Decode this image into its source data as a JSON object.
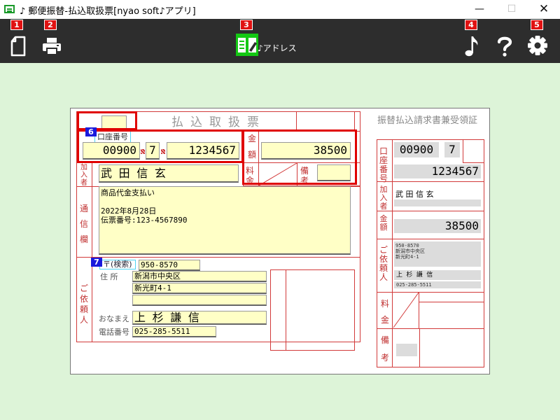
{
  "window": {
    "title": "♪ 郵便振替-払込取扱票[nyao soft♪アプリ]",
    "minimize_glyph": "—",
    "maximize_glyph": "☐",
    "close_glyph": "✕"
  },
  "toolbar": {
    "badges": [
      "1",
      "2",
      "3",
      "4",
      "5"
    ],
    "address_label": "♪アドレス",
    "icons": [
      "new-document-icon",
      "printer-icon",
      "address-book-icon",
      "music-note-icon",
      "help-icon",
      "gear-icon"
    ],
    "accent": "#14c814"
  },
  "form": {
    "title": "払込取扱票",
    "receipt_title": "振替払込請求書兼受領証",
    "tag_account": "6",
    "tag_postal": "7",
    "account": {
      "label": "口座番号",
      "part1": "00900",
      "part2": "7",
      "part3": "1234567"
    },
    "amount": {
      "label_1": "金",
      "label_2": "額",
      "value": "38500"
    },
    "fee": {
      "label_1": "料",
      "label_2": "金"
    },
    "remarks": {
      "label_1": "備",
      "label_2": "考"
    },
    "subscriber": {
      "label": "加入者",
      "name": "武 田 信 玄"
    },
    "message": {
      "label": "通信欄",
      "line1": "商品代金支払い",
      "line2": "2022年8月28日",
      "line3": "伝票番号:123-4567890"
    },
    "requester": {
      "label": "ご依頼人",
      "postal_button": "〒(検索)",
      "postal_code": "950-8570",
      "address_label": "住 所",
      "address_line1": "新潟市中央区",
      "address_line2": "新光町4-1",
      "address_line3": "",
      "name_label": "おなまえ",
      "name": "上 杉 謙 信",
      "phone_label": "電話番号",
      "phone": "025-285-5511"
    },
    "receipt": {
      "account_label": "口座番号",
      "account_part1": "00900",
      "account_part2": "7",
      "account_part3": "1234567",
      "subscriber_label": "加入者",
      "subscriber_name": "武 田 信 玄",
      "amount_label": "金額",
      "amount": "38500",
      "requester_label": "ご依頼人",
      "requester_addr1": "950-8570",
      "requester_addr2": "新潟市中央区",
      "requester_addr3": "新光町4-1",
      "requester_name": "上 杉 謙 信",
      "requester_phone": "025-285-5511",
      "fee_label_1": "料",
      "fee_label_2": "金",
      "remarks_label_1": "備",
      "remarks_label_2": "考"
    }
  }
}
